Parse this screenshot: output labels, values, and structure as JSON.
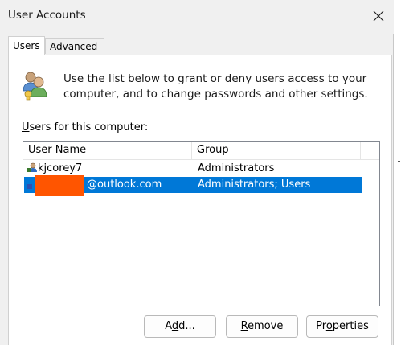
{
  "window": {
    "title": "User Accounts",
    "close_icon": "close-icon"
  },
  "tabs": [
    {
      "label": "Users",
      "active": true
    },
    {
      "label": "Advanced",
      "active": false
    }
  ],
  "intro_text": "Use the list below to grant or deny users access to your computer, and to change passwords and other settings.",
  "users_list": {
    "label_underlined": "U",
    "label_rest": "sers for this computer:",
    "columns": [
      "User Name",
      "Group"
    ],
    "rows": [
      {
        "name": "kjcorey7",
        "group": "Administrators",
        "selected": false,
        "icon": "user-icon"
      },
      {
        "name": "@outlook.com",
        "group": "Administrators; Users",
        "selected": true,
        "icon": "user-icon",
        "name_redacted": true
      }
    ]
  },
  "buttons": {
    "add": {
      "pre": "A",
      "u": "d",
      "post": "d..."
    },
    "remove": {
      "pre": "",
      "u": "R",
      "post": "emove"
    },
    "properties": {
      "pre": "Pr",
      "u": "o",
      "post": "perties"
    }
  },
  "colors": {
    "selection": "#0078d7",
    "redaction": "#ff5500",
    "window_bg": "#f0f0f0"
  }
}
